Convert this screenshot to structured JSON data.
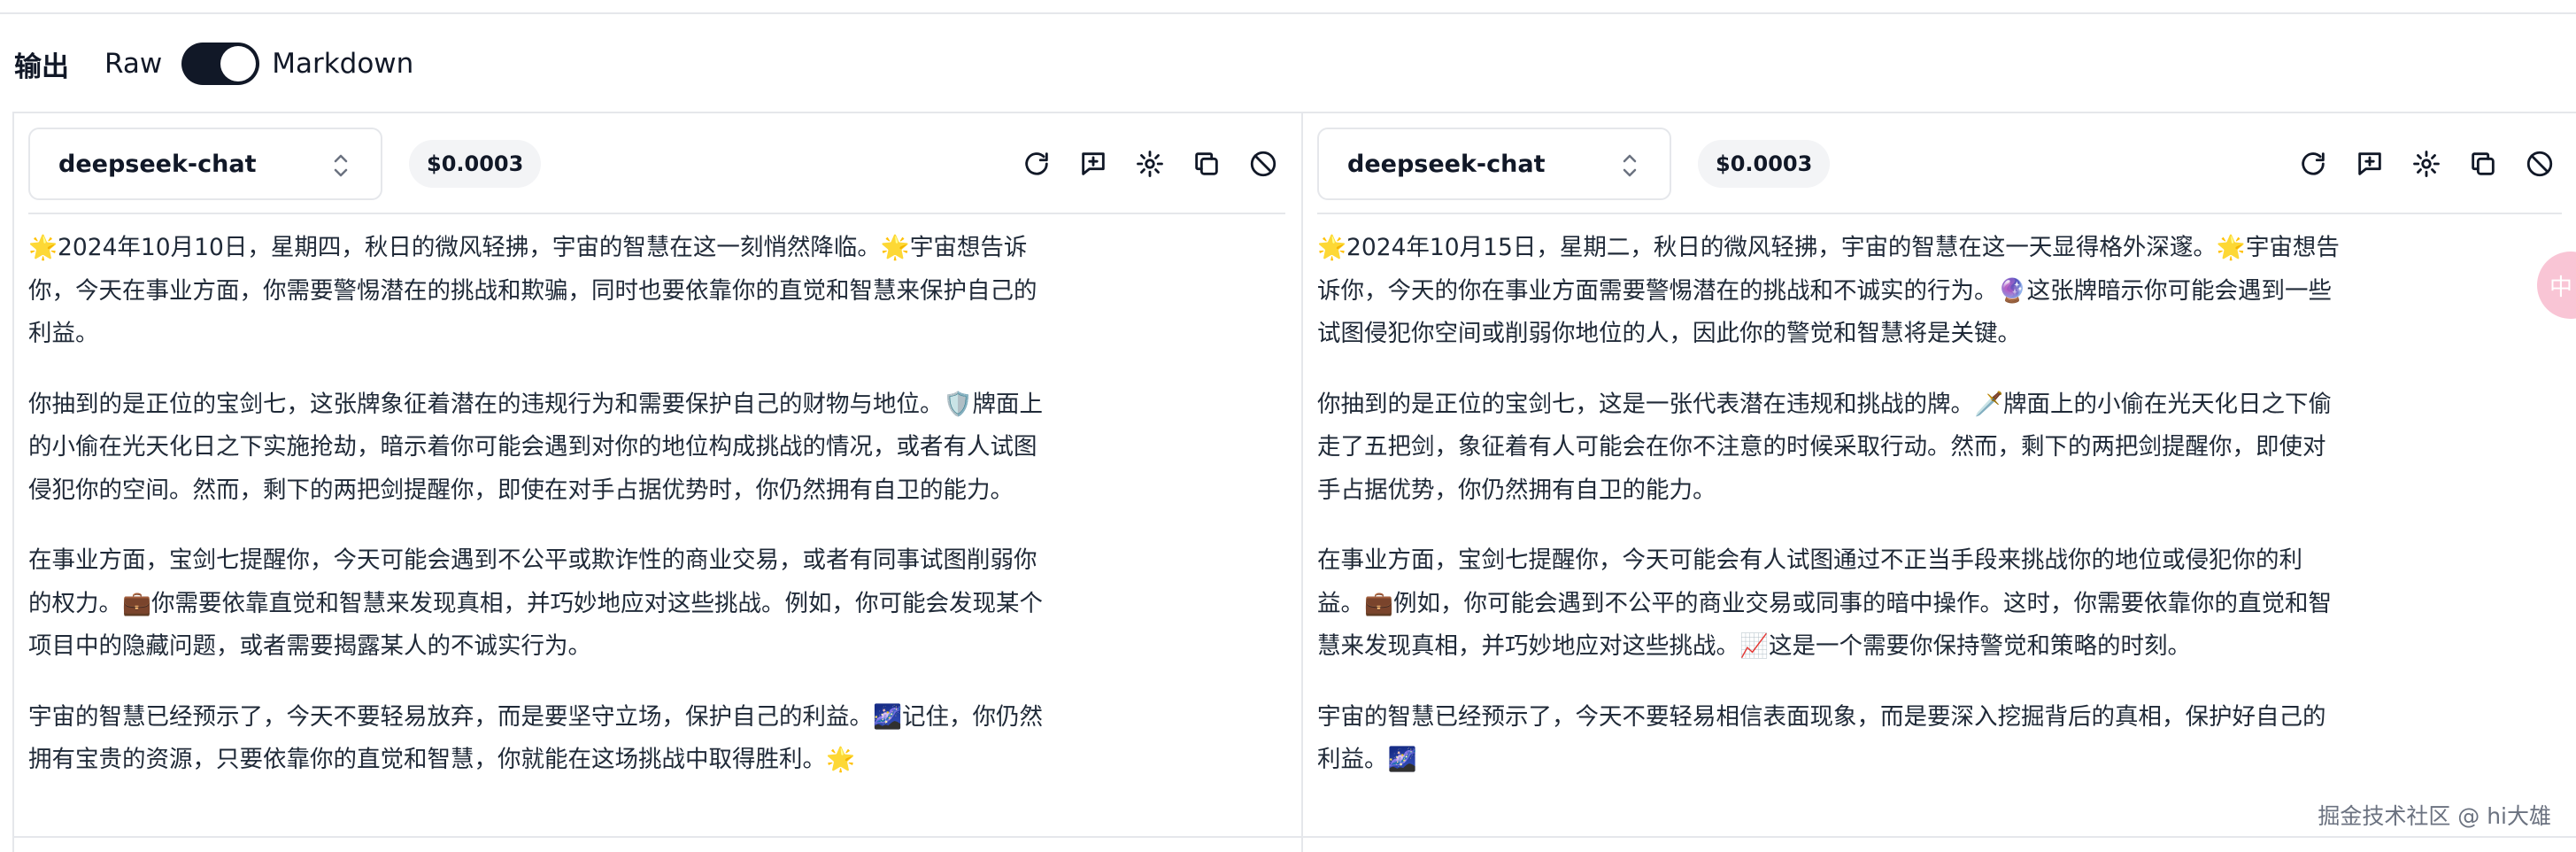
{
  "output_header": {
    "title": "输出",
    "raw_label": "Raw",
    "markdown_label": "Markdown",
    "markdown_enabled": true
  },
  "panels": [
    {
      "model": "deepseek-chat",
      "cost": "$0.0003",
      "paragraphs": [
        "🌟2024年10月10日，星期四，秋日的微风轻拂，宇宙的智慧在这一刻悄然降临。🌟宇宙想告诉你，今天在事业方面，你需要警惕潜在的挑战和欺骗，同时也要依靠你的直觉和智慧来保护自己的利益。",
        "你抽到的是正位的宝剑七，这张牌象征着潜在的违规行为和需要保护自己的财物与地位。🛡️牌面上的小偷在光天化日之下实施抢劫，暗示着你可能会遇到对你的地位构成挑战的情况，或者有人试图侵犯你的空间。然而，剩下的两把剑提醒你，即使在对手占据优势时，你仍然拥有自卫的能力。",
        "在事业方面，宝剑七提醒你，今天可能会遇到不公平或欺诈性的商业交易，或者有同事试图削弱你的权力。💼你需要依靠直觉和智慧来发现真相，并巧妙地应对这些挑战。例如，你可能会发现某个项目中的隐藏问题，或者需要揭露某人的不诚实行为。",
        "宇宙的智慧已经预示了，今天不要轻易放弃，而是要坚守立场，保护自己的利益。🌌记住，你仍然拥有宝贵的资源，只要依靠你的直觉和智慧，你就能在这场挑战中取得胜利。🌟"
      ]
    },
    {
      "model": "deepseek-chat",
      "cost": "$0.0003",
      "paragraphs": [
        "🌟2024年10月15日，星期二，秋日的微风轻拂，宇宙的智慧在这一天显得格外深邃。🌟宇宙想告诉你，今天的你在事业方面需要警惕潜在的挑战和不诚实的行为。🔮这张牌暗示你可能会遇到一些试图侵犯你空间或削弱你地位的人，因此你的警觉和智慧将是关键。",
        "你抽到的是正位的宝剑七，这是一张代表潜在违规和挑战的牌。🗡️牌面上的小偷在光天化日之下偷走了五把剑，象征着有人可能会在你不注意的时候采取行动。然而，剩下的两把剑提醒你，即使对手占据优势，你仍然拥有自卫的能力。",
        "在事业方面，宝剑七提醒你，今天可能会有人试图通过不正当手段来挑战你的地位或侵犯你的利益。💼例如，你可能会遇到不公平的商业交易或同事的暗中操作。这时，你需要依靠你的直觉和智慧来发现真相，并巧妙地应对这些挑战。📈这是一个需要你保持警觉和策略的时刻。",
        "宇宙的智慧已经预示了，今天不要轻易相信表面现象，而是要深入挖掘背后的真相，保护好自己的利益。🌌"
      ]
    }
  ],
  "toolbar_icons": [
    "refresh-icon",
    "message-plus-icon",
    "settings-gear-icon",
    "copy-icon",
    "ban-icon"
  ],
  "side_bubble_label": "中",
  "watermark": "掘金技术社区 @ hi大雄"
}
